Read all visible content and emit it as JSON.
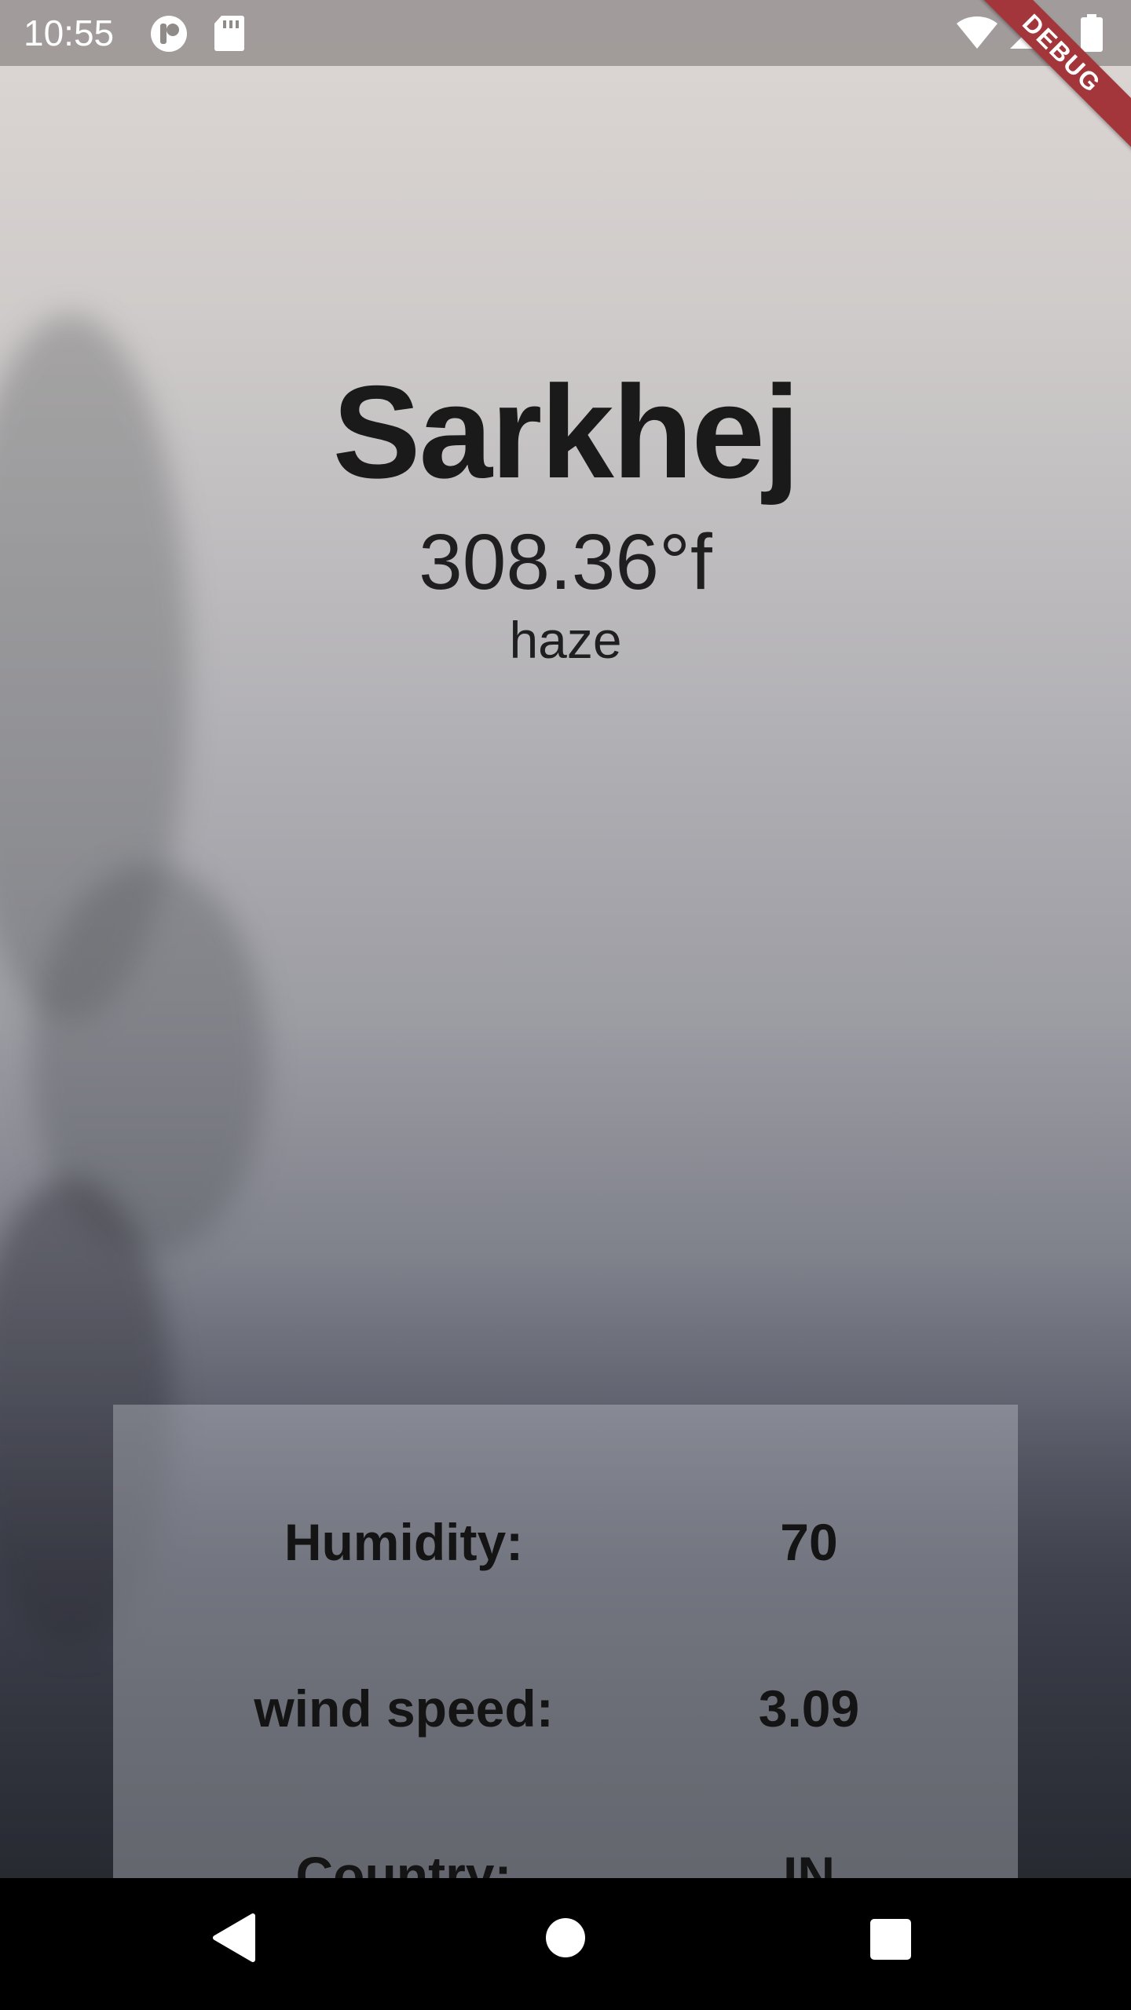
{
  "status_bar": {
    "time": "10:55",
    "icons": [
      "notification-app-icon",
      "sd-card-icon",
      "wifi-icon",
      "signal-icon",
      "battery-icon"
    ]
  },
  "debug_banner": "DEBUG",
  "weather": {
    "city": "Sarkhej",
    "temperature": "308.36°f",
    "description": "haze"
  },
  "details": [
    {
      "label": "Humidity:",
      "value": "70"
    },
    {
      "label": "wind speed:",
      "value": "3.09"
    },
    {
      "label": "Country:",
      "value": "IN"
    }
  ],
  "nav_bar": {
    "icons": [
      "back-icon",
      "home-icon",
      "recents-icon"
    ]
  },
  "colors": {
    "debug_ribbon": "#a2363a",
    "text": "#1a1a1a"
  }
}
